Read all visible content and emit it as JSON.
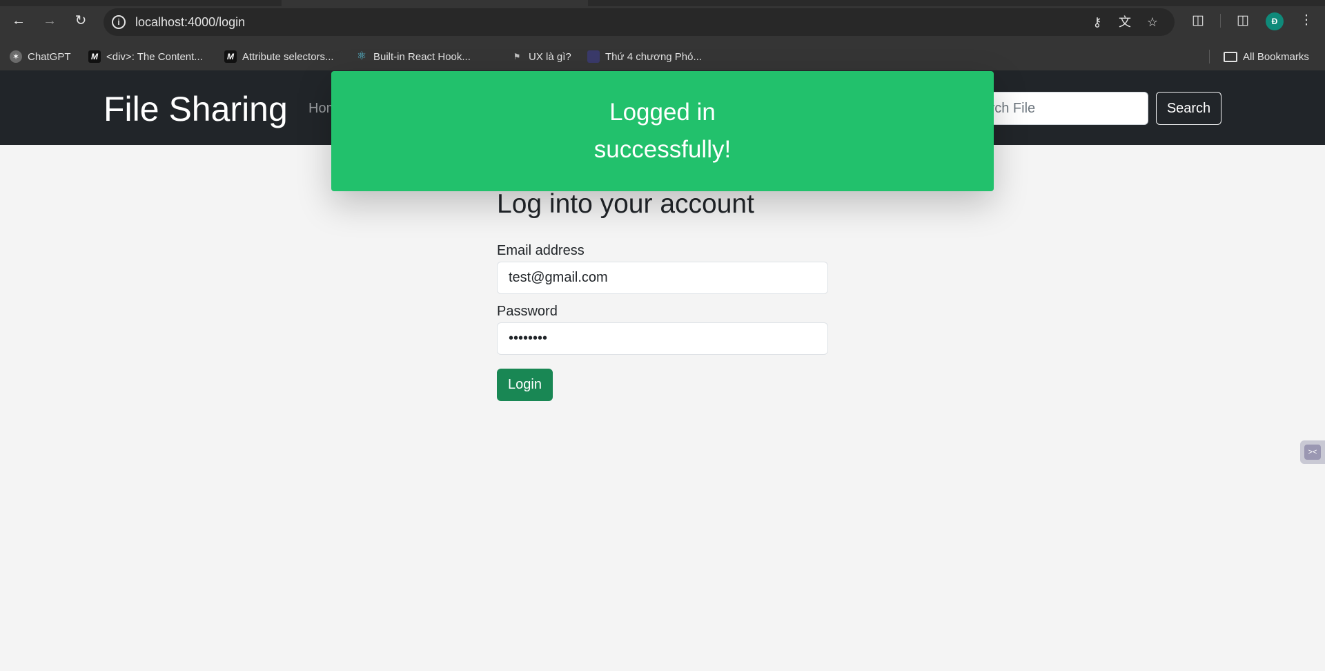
{
  "browser": {
    "url": "localhost:4000/login",
    "icons": {
      "back": "arrow-left-icon",
      "forward": "arrow-right-icon",
      "reload": "reload-icon",
      "site_info": "info-icon",
      "password": "key-icon",
      "translate": "translate-icon",
      "bookmark": "star-icon",
      "extensions": "puzzle-icon",
      "side_panel": "side-panel-icon",
      "menu": "kebab-menu-icon"
    },
    "avatar_letter": "Đ",
    "bookmarks": [
      {
        "label": "ChatGPT",
        "icon": "chatgpt-icon"
      },
      {
        "label": "<div>: The Content...",
        "icon": "mdn-icon"
      },
      {
        "label": "Attribute selectors...",
        "icon": "mdn-icon"
      },
      {
        "label": "Built-in React Hook...",
        "icon": "react-icon"
      },
      {
        "label": "UX là gì?",
        "icon": "ux-icon"
      },
      {
        "label": "Thứ 4 chương Phó...",
        "icon": "doc-icon"
      }
    ],
    "all_bookmarks_label": "All Bookmarks"
  },
  "navbar": {
    "brand": "File Sharing",
    "home_link": "Home",
    "search_placeholder": "Search File",
    "search_button": "Search"
  },
  "toast": {
    "message": "Logged in successfully!",
    "color": "#22c16c"
  },
  "login_form": {
    "title": "Log into your account",
    "email_label": "Email address",
    "email_value": "test@gmail.com",
    "password_label": "Password",
    "password_value": "12345678",
    "submit_label": "Login",
    "submit_color": "#198754"
  }
}
